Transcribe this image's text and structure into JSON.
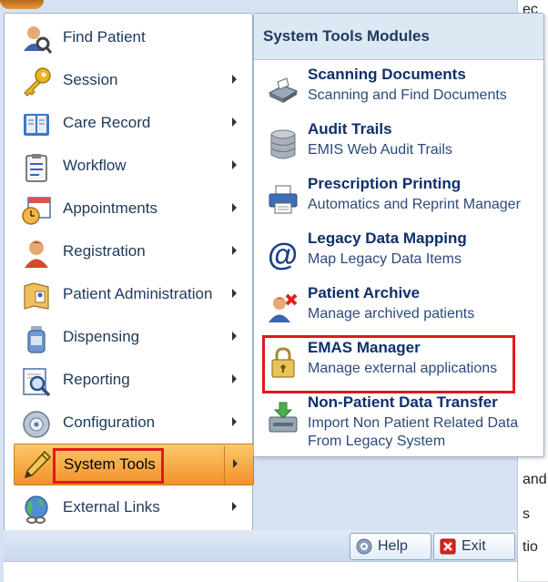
{
  "menu": {
    "items": [
      {
        "label": "Find Patient",
        "icon": "find-patient-icon",
        "has_submenu": false
      },
      {
        "label": "Session",
        "icon": "key-icon",
        "has_submenu": true
      },
      {
        "label": "Care Record",
        "icon": "care-record-book-icon",
        "has_submenu": true
      },
      {
        "label": "Workflow",
        "icon": "workflow-clipboard-icon",
        "has_submenu": true
      },
      {
        "label": "Appointments",
        "icon": "appointments-calendar-icon",
        "has_submenu": true
      },
      {
        "label": "Registration",
        "icon": "registration-person-icon",
        "has_submenu": true
      },
      {
        "label": "Patient Administration",
        "icon": "patient-admin-folder-icon",
        "has_submenu": true
      },
      {
        "label": "Dispensing",
        "icon": "dispensing-bottle-icon",
        "has_submenu": true
      },
      {
        "label": "Reporting",
        "icon": "reporting-magnifier-icon",
        "has_submenu": true
      },
      {
        "label": "Configuration",
        "icon": "configuration-disk-icon",
        "has_submenu": true
      },
      {
        "label": "System Tools",
        "icon": "pencil-icon",
        "has_submenu": true,
        "selected": true
      },
      {
        "label": "External Links",
        "icon": "globe-icon",
        "has_submenu": true
      }
    ]
  },
  "submenu": {
    "title": "System Tools Modules",
    "items": [
      {
        "title": "Scanning  Documents",
        "description": "Scanning and Find Documents",
        "icon": "scanner-icon"
      },
      {
        "title": "Audit Trails",
        "description": "EMIS Web Audit Trails",
        "icon": "database-icon"
      },
      {
        "title": "Prescription Printing",
        "description": "Automatics and Reprint Manager",
        "icon": "printer-icon"
      },
      {
        "title": "Legacy Data Mapping",
        "description": "Map Legacy Data Items",
        "icon": "at-sign-icon"
      },
      {
        "title": "Patient Archive",
        "description": "Manage archived patients",
        "icon": "patient-archive-icon"
      },
      {
        "title": "EMAS Manager",
        "description": "Manage external applications",
        "icon": "padlock-icon"
      },
      {
        "title": "Non-Patient Data Transfer",
        "description": "Import Non Patient Related Data",
        "description2": "From Legacy System",
        "icon": "data-transfer-icon"
      }
    ]
  },
  "footer": {
    "help_label": "Help",
    "exit_label": "Exit"
  },
  "background": {
    "fragments": [
      "ec",
      "and",
      "s",
      "tio"
    ]
  },
  "colors": {
    "highlight": "#e0191b",
    "selected_gradient_top": "#fbc86a",
    "selected_gradient_bottom": "#f3912a",
    "title_text": "#0f2f6b"
  }
}
